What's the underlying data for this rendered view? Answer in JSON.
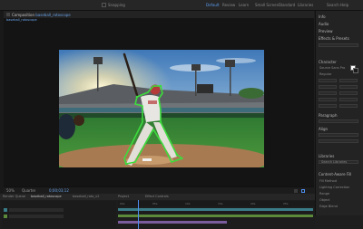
{
  "toolbar": {
    "tools": [
      "home-icon",
      "selection-icon",
      "hand-icon",
      "zoom-icon",
      "rotate-icon",
      "camera-icon",
      "pan-behind-icon",
      "rectangle-icon",
      "pen-icon",
      "type-icon",
      "brush-icon",
      "clone-stamp-icon",
      "eraser-icon",
      "roto-brush-icon",
      "puppet-pin-icon"
    ],
    "snapping_label": "Snapping",
    "workspaces": [
      "Default",
      "Review",
      "Learn",
      "Small Screen",
      "Standard",
      "Libraries"
    ],
    "active_workspace": "Default",
    "search_label": "Search Help"
  },
  "comp_panel": {
    "tab_label": "Composition",
    "comp_name": "baseball_rotoscope",
    "breadcrumb": "baseball_rotoscope",
    "mask_color": "#3ddc3d"
  },
  "comp_footer": {
    "zoom": "50%",
    "resolution": "Quarter",
    "timecode": "0;00;03;12"
  },
  "right_panel": {
    "info_title": "Info",
    "audio_title": "Audio",
    "preview_title": "Preview",
    "effects_title": "Effects & Presets",
    "character_title": "Character",
    "font_name": "Source Sans Pro",
    "font_style": "Regular",
    "paragraph_title": "Paragraph",
    "align_title": "Align",
    "libraries_title": "Libraries",
    "libraries_search": "Search Libraries",
    "content_aware_title": "Content-Aware Fill",
    "fill_options": [
      "Fill Method",
      "Lighting Correction",
      "Range",
      "Object",
      "Edge Blend"
    ]
  },
  "timeline": {
    "tabs": [
      "Render Queue",
      "baseball_rotoscope",
      "baseball_roto_v2",
      "Project",
      "Effect Controls"
    ],
    "ruler_labels": [
      "00s",
      "05s",
      "10s",
      "15s",
      "20s",
      "25s"
    ],
    "track_colors": [
      "#3a7d88",
      "#5b8a3a",
      "#7a5c9c"
    ]
  }
}
